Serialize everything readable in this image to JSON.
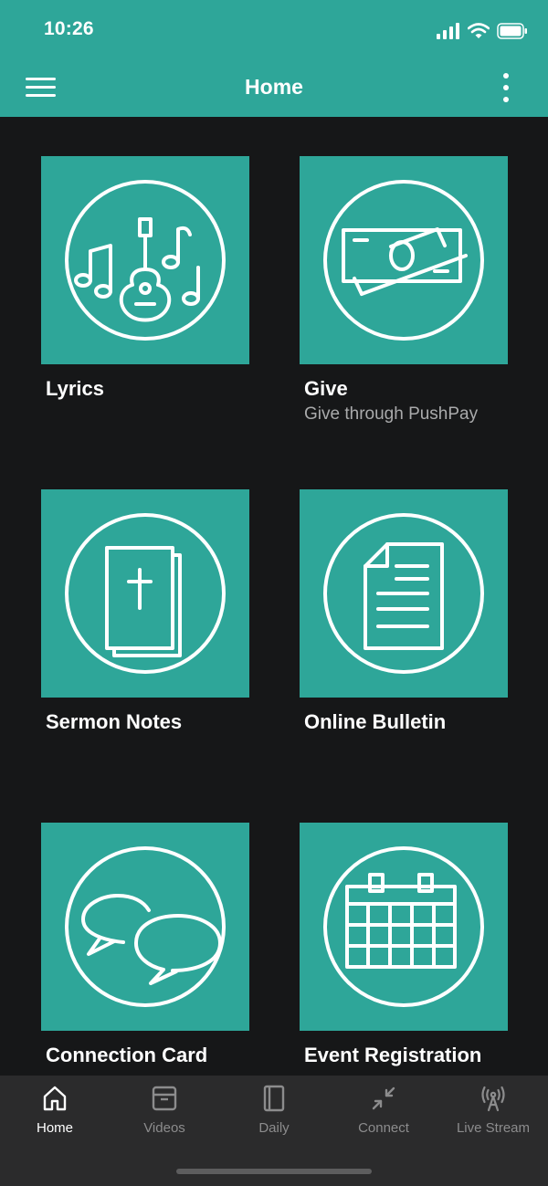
{
  "status": {
    "time": "10:26"
  },
  "nav": {
    "title": "Home"
  },
  "tiles": [
    {
      "title": "Lyrics",
      "subtitle": "",
      "icon": "guitar-music-icon"
    },
    {
      "title": "Give",
      "subtitle": "Give through PushPay",
      "icon": "money-icon"
    },
    {
      "title": "Sermon Notes",
      "subtitle": "",
      "icon": "bible-icon"
    },
    {
      "title": "Online Bulletin",
      "subtitle": "",
      "icon": "document-icon"
    },
    {
      "title": "Connection Card",
      "subtitle": "",
      "icon": "speech-bubbles-icon"
    },
    {
      "title": "Event Registration",
      "subtitle": "",
      "icon": "calendar-icon"
    }
  ],
  "tabs": [
    {
      "label": "Home",
      "icon": "home-icon",
      "active": true
    },
    {
      "label": "Videos",
      "icon": "archive-box-icon",
      "active": false
    },
    {
      "label": "Daily",
      "icon": "book-icon",
      "active": false
    },
    {
      "label": "Connect",
      "icon": "arrows-in-icon",
      "active": false
    },
    {
      "label": "Live Stream",
      "icon": "broadcast-icon",
      "active": false
    }
  ],
  "colors": {
    "accent": "#2ea699",
    "background": "#161718",
    "tab_bar": "#2b2b2c",
    "inactive": "#8c8c8d"
  }
}
